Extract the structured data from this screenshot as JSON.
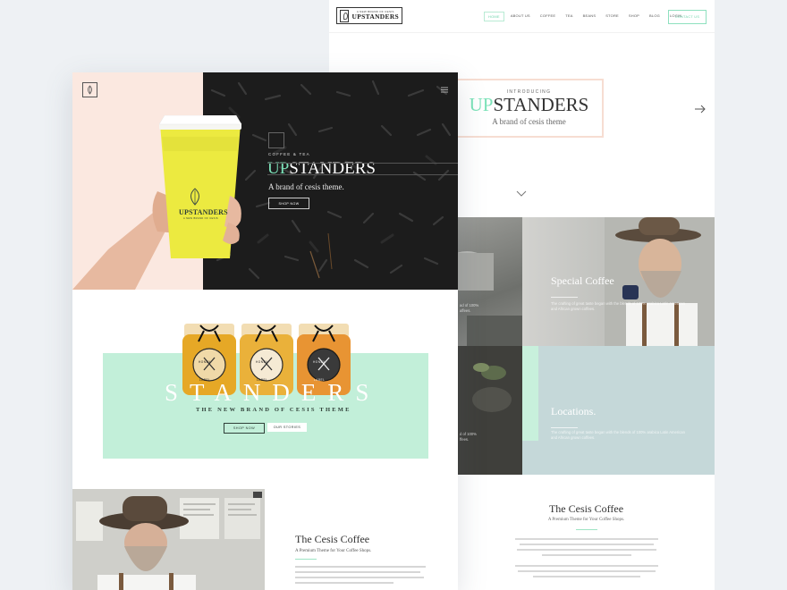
{
  "back_page": {
    "logo": {
      "small": "A NEW BRAND OF CESIS",
      "text": "UPSTANDERS"
    },
    "nav": [
      "HOME",
      "ABOUT US",
      "COFFEE",
      "TEA",
      "BEANS",
      "STORE",
      "SHOP",
      "BLOG",
      "LOGIN"
    ],
    "nav_active": "HOME",
    "contact_label": "CONTACT US",
    "intro": {
      "small": "INTRODUCING",
      "title_accent": "UP",
      "title_rest": "STANDERS",
      "subtitle": "A brand of cesis theme"
    },
    "cells": {
      "special": {
        "title": "Special Coffee",
        "text": "The crafting of great taste began with the blends of 100% arabica Latin American and African grown coffees.",
        "left_fragment": "ad of 100%\naffees."
      },
      "locations": {
        "title": "Locations.",
        "text": "The crafting of great taste began with the blends of 100% arabica Latin American and African grown coffees.",
        "left_fragment": "d of 100%\nffees."
      }
    },
    "section": {
      "title": "The Cesis Coffee",
      "subtitle": "A Premium Theme for Your Coffee Shops."
    }
  },
  "front_page": {
    "cup_brand": "UPSTANDERS",
    "cup_small": "A NEW BRAND OF CESIS",
    "hero": {
      "small": "COFFEE & TEA",
      "title_accent": "UP",
      "title_rest": "STANDERS",
      "subtitle": "A brand of cesis theme.",
      "button": "SHOP NOW"
    },
    "jars": [
      {
        "line1": "HONEY",
        "line2": "LABEL"
      },
      {
        "line1": "HONEY",
        "line2": "LABEL"
      },
      {
        "line1": "HONEY",
        "line2": "LABEL"
      }
    ],
    "band": {
      "big": "STANDERS",
      "subtitle": "THE NEW BRAND OF CESIS THEME",
      "btn1": "SHOP NOW",
      "btn2": "OUR STORIES"
    },
    "section": {
      "title": "The Cesis Coffee",
      "subtitle": "A Premium Theme for Your Coffee Shops."
    }
  },
  "colors": {
    "accent": "#7ce2b9",
    "mint_band": "#c2efd9",
    "peach": "#fbe8e0",
    "cup_yellow": "#ecea40",
    "locations_bg": "#c5d8d9"
  }
}
